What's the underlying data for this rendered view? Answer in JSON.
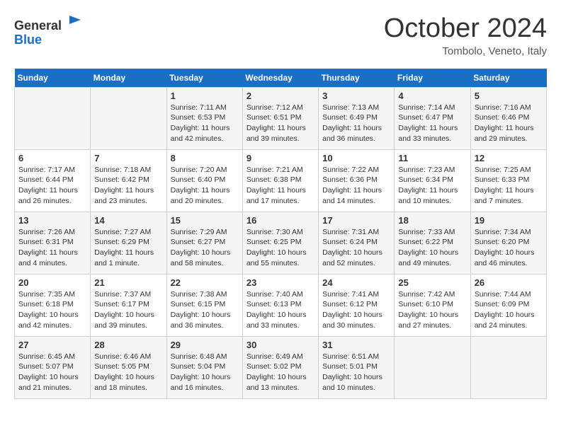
{
  "logo": {
    "general": "General",
    "blue": "Blue"
  },
  "title": "October 2024",
  "location": "Tombolo, Veneto, Italy",
  "headers": [
    "Sunday",
    "Monday",
    "Tuesday",
    "Wednesday",
    "Thursday",
    "Friday",
    "Saturday"
  ],
  "weeks": [
    [
      {
        "day": "",
        "sunrise": "",
        "sunset": "",
        "daylight": ""
      },
      {
        "day": "",
        "sunrise": "",
        "sunset": "",
        "daylight": ""
      },
      {
        "day": "1",
        "sunrise": "Sunrise: 7:11 AM",
        "sunset": "Sunset: 6:53 PM",
        "daylight": "Daylight: 11 hours and 42 minutes."
      },
      {
        "day": "2",
        "sunrise": "Sunrise: 7:12 AM",
        "sunset": "Sunset: 6:51 PM",
        "daylight": "Daylight: 11 hours and 39 minutes."
      },
      {
        "day": "3",
        "sunrise": "Sunrise: 7:13 AM",
        "sunset": "Sunset: 6:49 PM",
        "daylight": "Daylight: 11 hours and 36 minutes."
      },
      {
        "day": "4",
        "sunrise": "Sunrise: 7:14 AM",
        "sunset": "Sunset: 6:47 PM",
        "daylight": "Daylight: 11 hours and 33 minutes."
      },
      {
        "day": "5",
        "sunrise": "Sunrise: 7:16 AM",
        "sunset": "Sunset: 6:46 PM",
        "daylight": "Daylight: 11 hours and 29 minutes."
      }
    ],
    [
      {
        "day": "6",
        "sunrise": "Sunrise: 7:17 AM",
        "sunset": "Sunset: 6:44 PM",
        "daylight": "Daylight: 11 hours and 26 minutes."
      },
      {
        "day": "7",
        "sunrise": "Sunrise: 7:18 AM",
        "sunset": "Sunset: 6:42 PM",
        "daylight": "Daylight: 11 hours and 23 minutes."
      },
      {
        "day": "8",
        "sunrise": "Sunrise: 7:20 AM",
        "sunset": "Sunset: 6:40 PM",
        "daylight": "Daylight: 11 hours and 20 minutes."
      },
      {
        "day": "9",
        "sunrise": "Sunrise: 7:21 AM",
        "sunset": "Sunset: 6:38 PM",
        "daylight": "Daylight: 11 hours and 17 minutes."
      },
      {
        "day": "10",
        "sunrise": "Sunrise: 7:22 AM",
        "sunset": "Sunset: 6:36 PM",
        "daylight": "Daylight: 11 hours and 14 minutes."
      },
      {
        "day": "11",
        "sunrise": "Sunrise: 7:23 AM",
        "sunset": "Sunset: 6:34 PM",
        "daylight": "Daylight: 11 hours and 10 minutes."
      },
      {
        "day": "12",
        "sunrise": "Sunrise: 7:25 AM",
        "sunset": "Sunset: 6:33 PM",
        "daylight": "Daylight: 11 hours and 7 minutes."
      }
    ],
    [
      {
        "day": "13",
        "sunrise": "Sunrise: 7:26 AM",
        "sunset": "Sunset: 6:31 PM",
        "daylight": "Daylight: 11 hours and 4 minutes."
      },
      {
        "day": "14",
        "sunrise": "Sunrise: 7:27 AM",
        "sunset": "Sunset: 6:29 PM",
        "daylight": "Daylight: 11 hours and 1 minute."
      },
      {
        "day": "15",
        "sunrise": "Sunrise: 7:29 AM",
        "sunset": "Sunset: 6:27 PM",
        "daylight": "Daylight: 10 hours and 58 minutes."
      },
      {
        "day": "16",
        "sunrise": "Sunrise: 7:30 AM",
        "sunset": "Sunset: 6:25 PM",
        "daylight": "Daylight: 10 hours and 55 minutes."
      },
      {
        "day": "17",
        "sunrise": "Sunrise: 7:31 AM",
        "sunset": "Sunset: 6:24 PM",
        "daylight": "Daylight: 10 hours and 52 minutes."
      },
      {
        "day": "18",
        "sunrise": "Sunrise: 7:33 AM",
        "sunset": "Sunset: 6:22 PM",
        "daylight": "Daylight: 10 hours and 49 minutes."
      },
      {
        "day": "19",
        "sunrise": "Sunrise: 7:34 AM",
        "sunset": "Sunset: 6:20 PM",
        "daylight": "Daylight: 10 hours and 46 minutes."
      }
    ],
    [
      {
        "day": "20",
        "sunrise": "Sunrise: 7:35 AM",
        "sunset": "Sunset: 6:18 PM",
        "daylight": "Daylight: 10 hours and 42 minutes."
      },
      {
        "day": "21",
        "sunrise": "Sunrise: 7:37 AM",
        "sunset": "Sunset: 6:17 PM",
        "daylight": "Daylight: 10 hours and 39 minutes."
      },
      {
        "day": "22",
        "sunrise": "Sunrise: 7:38 AM",
        "sunset": "Sunset: 6:15 PM",
        "daylight": "Daylight: 10 hours and 36 minutes."
      },
      {
        "day": "23",
        "sunrise": "Sunrise: 7:40 AM",
        "sunset": "Sunset: 6:13 PM",
        "daylight": "Daylight: 10 hours and 33 minutes."
      },
      {
        "day": "24",
        "sunrise": "Sunrise: 7:41 AM",
        "sunset": "Sunset: 6:12 PM",
        "daylight": "Daylight: 10 hours and 30 minutes."
      },
      {
        "day": "25",
        "sunrise": "Sunrise: 7:42 AM",
        "sunset": "Sunset: 6:10 PM",
        "daylight": "Daylight: 10 hours and 27 minutes."
      },
      {
        "day": "26",
        "sunrise": "Sunrise: 7:44 AM",
        "sunset": "Sunset: 6:09 PM",
        "daylight": "Daylight: 10 hours and 24 minutes."
      }
    ],
    [
      {
        "day": "27",
        "sunrise": "Sunrise: 6:45 AM",
        "sunset": "Sunset: 5:07 PM",
        "daylight": "Daylight: 10 hours and 21 minutes."
      },
      {
        "day": "28",
        "sunrise": "Sunrise: 6:46 AM",
        "sunset": "Sunset: 5:05 PM",
        "daylight": "Daylight: 10 hours and 18 minutes."
      },
      {
        "day": "29",
        "sunrise": "Sunrise: 6:48 AM",
        "sunset": "Sunset: 5:04 PM",
        "daylight": "Daylight: 10 hours and 16 minutes."
      },
      {
        "day": "30",
        "sunrise": "Sunrise: 6:49 AM",
        "sunset": "Sunset: 5:02 PM",
        "daylight": "Daylight: 10 hours and 13 minutes."
      },
      {
        "day": "31",
        "sunrise": "Sunrise: 6:51 AM",
        "sunset": "Sunset: 5:01 PM",
        "daylight": "Daylight: 10 hours and 10 minutes."
      },
      {
        "day": "",
        "sunrise": "",
        "sunset": "",
        "daylight": ""
      },
      {
        "day": "",
        "sunrise": "",
        "sunset": "",
        "daylight": ""
      }
    ]
  ]
}
